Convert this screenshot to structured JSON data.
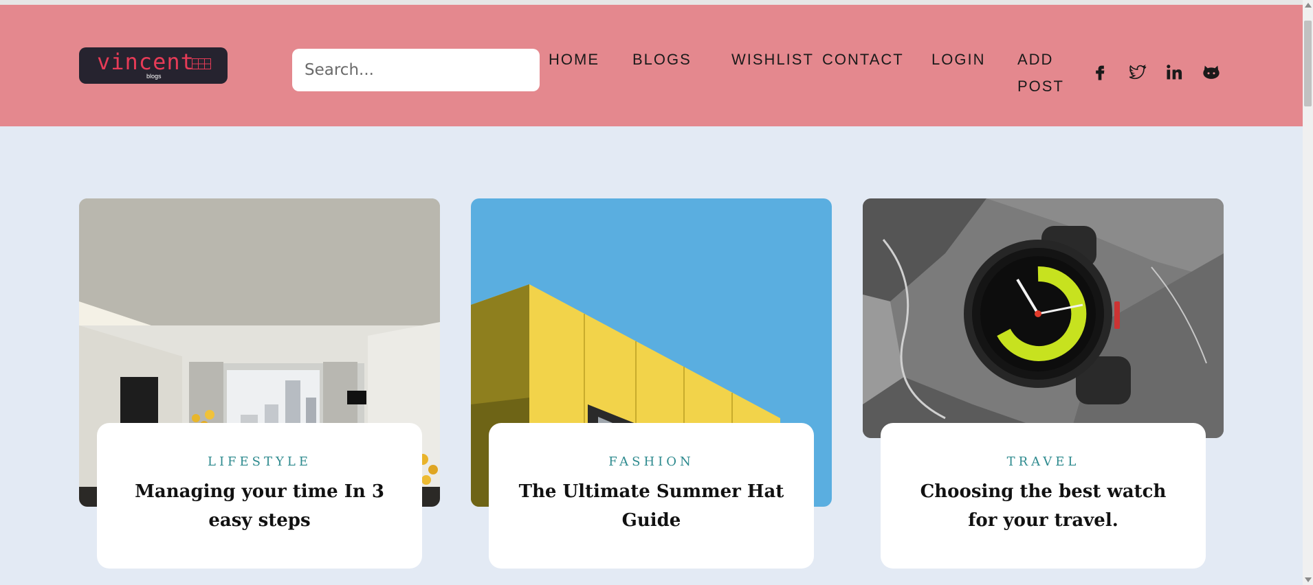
{
  "header": {
    "logo": {
      "name": "vincent",
      "sub": "blogs"
    },
    "search": {
      "placeholder": "Search..."
    },
    "nav": [
      {
        "label": "HOME"
      },
      {
        "label": "BLOGS"
      },
      {
        "label": "WISHLIST"
      },
      {
        "label": "CONTACT"
      },
      {
        "label": "LOGIN"
      },
      {
        "label": "ADD POST"
      }
    ],
    "social": [
      "facebook-icon",
      "twitter-icon",
      "linkedin-icon",
      "github-icon"
    ]
  },
  "colors": {
    "header_bg": "#e4888e",
    "page_bg": "#e3eaf4",
    "logo_bg": "#26232f",
    "logo_accent": "#e73b57",
    "category": "#2d8a8e"
  },
  "posts": [
    {
      "category": "LIFESTYLE",
      "title": "Managing your time In 3 easy steps",
      "image": "modern-living-room"
    },
    {
      "category": "FASHION",
      "title": "The Ultimate Summer Hat Guide",
      "image": "yellow-building-blue-sky"
    },
    {
      "category": "TRAVEL",
      "title": "Choosing the best watch for your travel.",
      "image": "smartwatch-on-rock"
    }
  ]
}
